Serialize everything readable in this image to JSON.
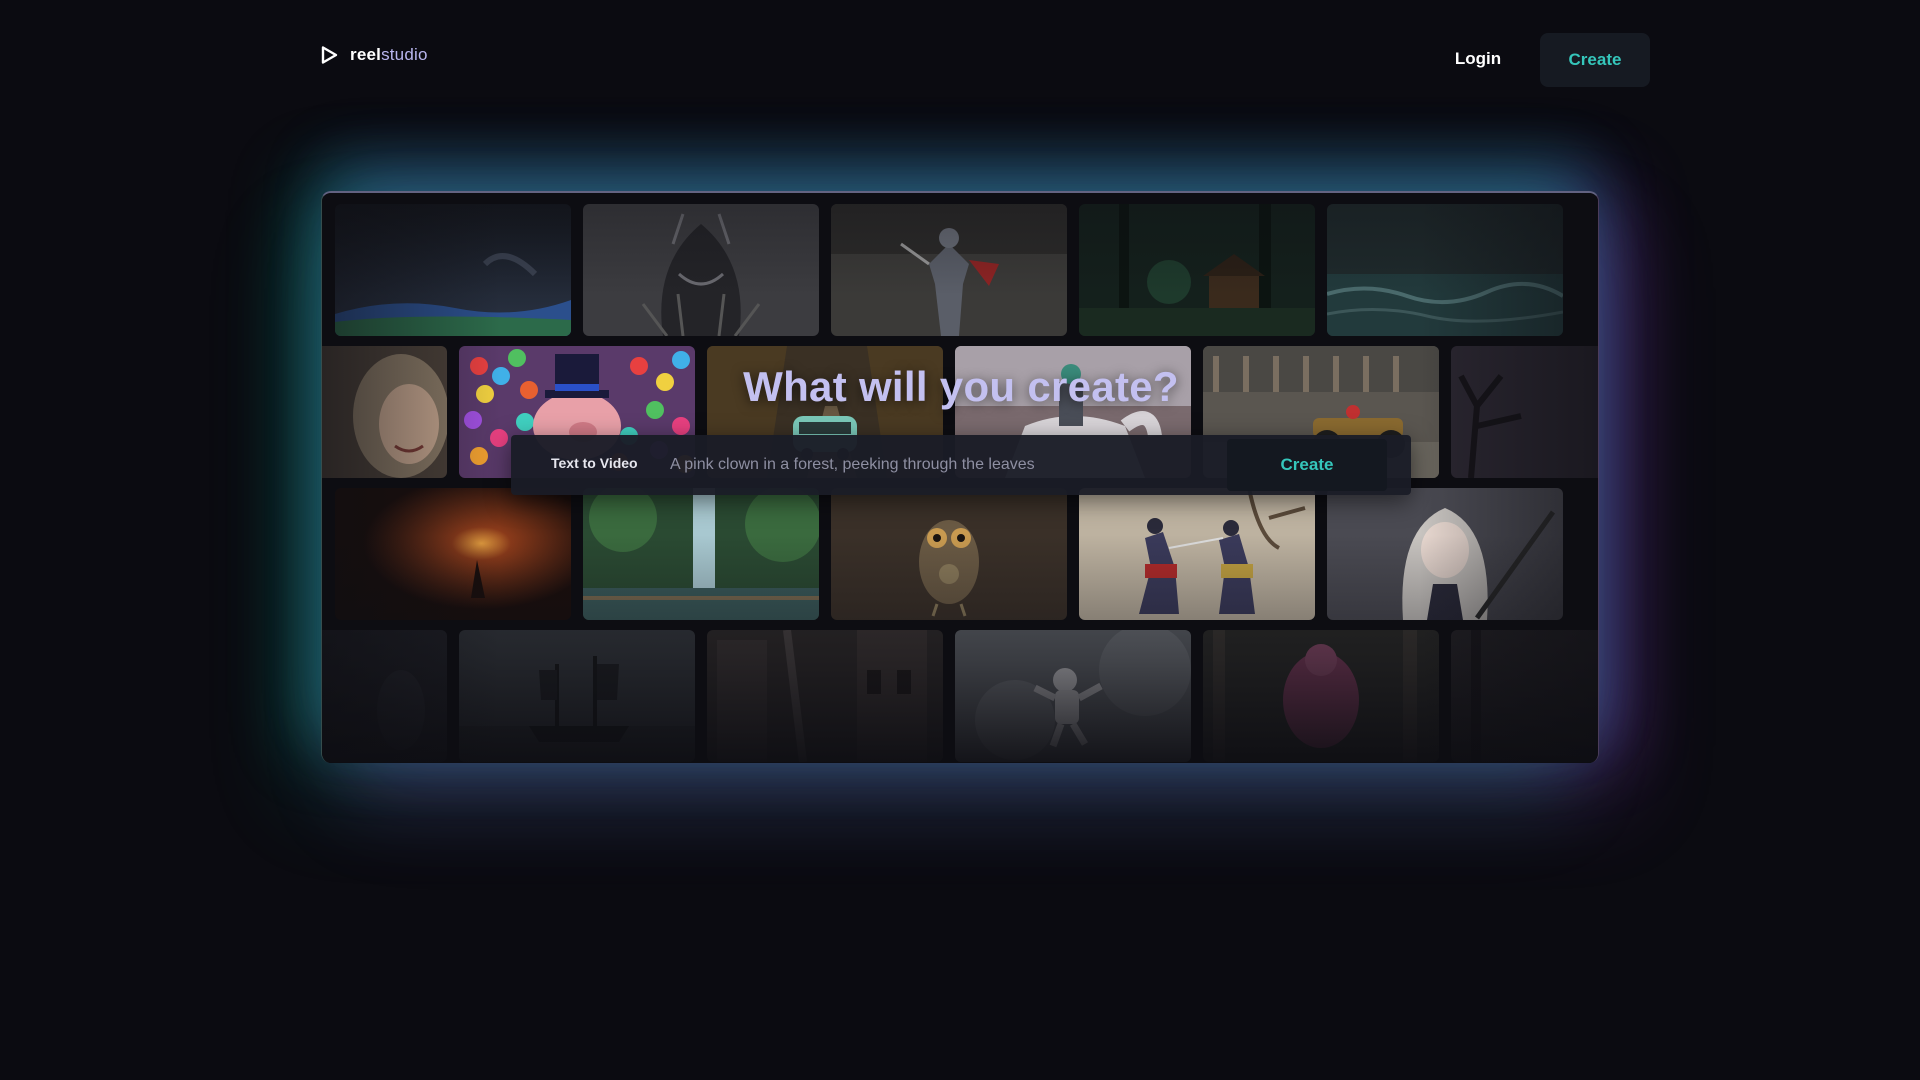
{
  "brand": {
    "name_bold": "reel",
    "name_light": "studio",
    "icon": "play-triangle-icon"
  },
  "nav": {
    "login_label": "Login",
    "create_label": "Create"
  },
  "hero": {
    "title": "What will you create?",
    "mode_label": "Text to Video",
    "prompt_placeholder": "A pink clown in a forest, peeking through the leaves",
    "create_label": "Create"
  },
  "gallery": {
    "rows": [
      [
        "coastal-landscape",
        "hairy-monster-sketch",
        "armored-knight-battle",
        "forest-cabin-night",
        "stormy-sea"
      ],
      [
        "smiling-woman-portrait",
        "pig-in-top-hat-ball-pit",
        "green-van-forest-road",
        "knight-on-horse",
        "vintage-race-car",
        "dark-tree-silhouette"
      ],
      [
        "cave-torch-explorer",
        "waterfall-jungle",
        "steampunk-owl",
        "samurai-duel",
        "anime-swordswoman"
      ],
      [
        "dark-figure",
        "pirate-ship",
        "ruined-gothic-city",
        "astronaut-floating",
        "pink-ape-forest",
        "dark-edge"
      ]
    ]
  },
  "colors": {
    "background": "#0b0b11",
    "accent": "#35c6bb",
    "title": "#c3c0f0",
    "glow_left": "#10c8a0",
    "glow_right": "#a050e6"
  }
}
